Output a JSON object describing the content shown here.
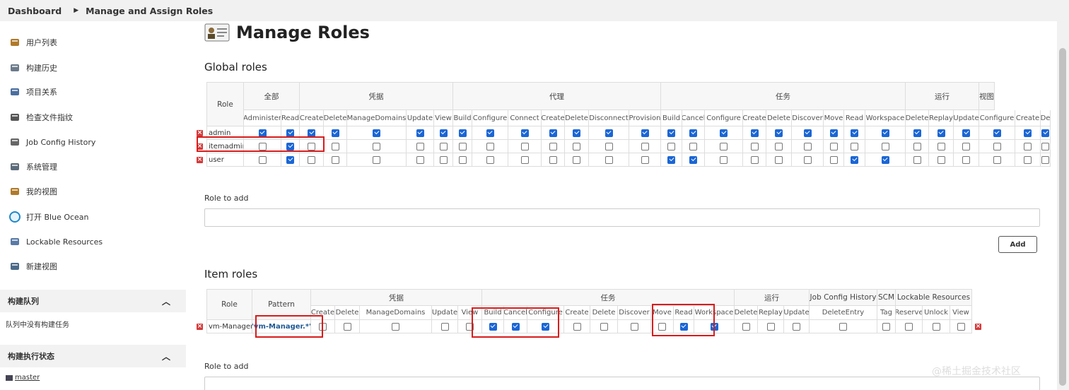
{
  "breadcrumb": {
    "home": "Dashboard",
    "current": "Manage and Assign Roles"
  },
  "sidebar": {
    "tasks": [
      {
        "label": "用户列表",
        "icon": "users-icon"
      },
      {
        "label": "构建历史",
        "icon": "build-history-icon"
      },
      {
        "label": "项目关系",
        "icon": "search-icon"
      },
      {
        "label": "检查文件指纹",
        "icon": "fingerprint-icon"
      },
      {
        "label": "Job Config History",
        "icon": "config-history-icon"
      },
      {
        "label": "系统管理",
        "icon": "gear-icon"
      },
      {
        "label": "我的视图",
        "icon": "user-view-icon"
      },
      {
        "label": "打开 Blue Ocean",
        "icon": "blue-ocean-icon"
      },
      {
        "label": "Lockable Resources",
        "icon": "lock-icon"
      },
      {
        "label": "新建视图",
        "icon": "folder-icon"
      }
    ],
    "build_queue": {
      "title": "构建队列",
      "empty_text": "队列中没有构建任务"
    },
    "executors": {
      "title": "构建执行状态",
      "node": "master"
    }
  },
  "main": {
    "title": "Manage Roles",
    "global": {
      "heading": "Global roles",
      "role_header": "Role",
      "groups": [
        "全部",
        "凭据",
        "代理",
        "任务",
        "运行",
        "视图"
      ],
      "perms": [
        "Administer",
        "Read",
        "Create",
        "Delete",
        "ManageDomains",
        "Update",
        "View",
        "Build",
        "Configure",
        "Connect",
        "Create",
        "Delete",
        "Disconnect",
        "Provision",
        "Build",
        "Cancel",
        "Configure",
        "Create",
        "Delete",
        "Discover",
        "Move",
        "Read",
        "Workspace",
        "Delete",
        "Replay",
        "Update",
        "Configure",
        "Create",
        "De"
      ],
      "rows": [
        {
          "name": "admin",
          "checks": [
            1,
            1,
            1,
            1,
            1,
            1,
            1,
            1,
            1,
            1,
            1,
            1,
            1,
            1,
            1,
            1,
            1,
            1,
            1,
            1,
            1,
            1,
            1,
            1,
            1,
            1,
            1,
            1,
            1
          ]
        },
        {
          "name": "itemadmin",
          "checks": [
            0,
            1,
            0,
            0,
            0,
            0,
            0,
            0,
            0,
            0,
            0,
            0,
            0,
            0,
            0,
            0,
            0,
            0,
            0,
            0,
            0,
            0,
            0,
            0,
            0,
            0,
            0,
            0,
            0
          ]
        },
        {
          "name": "user",
          "checks": [
            0,
            1,
            0,
            0,
            0,
            0,
            0,
            0,
            0,
            0,
            0,
            0,
            0,
            0,
            1,
            1,
            0,
            0,
            0,
            0,
            0,
            1,
            1,
            0,
            0,
            0,
            0,
            0,
            0
          ]
        }
      ],
      "role_to_add_label": "Role to add",
      "add_label": "Add"
    },
    "item": {
      "heading": "Item roles",
      "role_header": "Role",
      "pattern_header": "Pattern",
      "groups": [
        "凭据",
        "任务",
        "运行",
        "Job Config History",
        "SCM",
        "Lockable Resources"
      ],
      "perms": [
        "Create",
        "Delete",
        "ManageDomains",
        "Update",
        "View",
        "Build",
        "Cancel",
        "Configure",
        "Create",
        "Delete",
        "Discover",
        "Move",
        "Read",
        "Workspace",
        "Delete",
        "Replay",
        "Update",
        "DeleteEntry",
        "Tag",
        "Reserve",
        "Unlock",
        "View"
      ],
      "rows": [
        {
          "name": "vm-Manager",
          "pattern": "\"vm-Manager.*\"",
          "checks": [
            0,
            0,
            0,
            0,
            0,
            1,
            1,
            1,
            0,
            0,
            0,
            0,
            1,
            1,
            0,
            0,
            0,
            0,
            0,
            0,
            0,
            0
          ]
        }
      ],
      "role_to_add_label": "Role to add"
    }
  },
  "watermark": "@稀土掘金技术社区",
  "colors": {
    "checkbox_on": "#1a66d6",
    "highlight": "#d81c1c",
    "delete": "#d43a3a"
  }
}
